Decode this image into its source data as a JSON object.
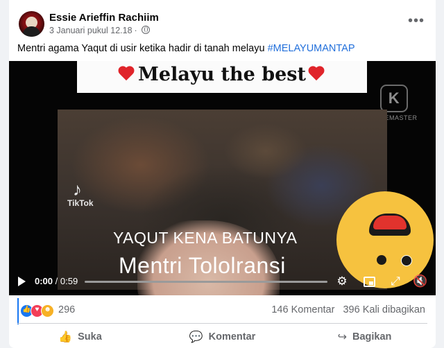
{
  "post": {
    "author": "Essie Arieffin Rachiim",
    "date": "3 Januari pukul 12.18",
    "separator": "·",
    "caption": "Mentri agama Yaqut  di usir ketika hadir di tanah  melayu",
    "hashtag": "#MELAYUMANTAP"
  },
  "video": {
    "banner_text": "Melayu the best",
    "watermark": "KINEMASTER",
    "tiktok_label": "TikTok",
    "overlay_line1": "YAQUT KENA BATUNYA",
    "overlay_line2": "Mentri Tololransi",
    "time_current": "0:00",
    "time_total": "/ 0:59",
    "progress": 0
  },
  "engagement": {
    "reaction_count": "296",
    "comments": "146 Komentar",
    "shares": "396 Kali dibagikan"
  },
  "actions": {
    "like": "Suka",
    "comment": "Komentar",
    "share": "Bagikan"
  },
  "icons": {
    "more": "more-options-icon",
    "globe": "globe-icon",
    "play": "play-icon",
    "settings": "gear-icon",
    "pip": "pip-icon",
    "fullscreen": "fullscreen-icon",
    "mute": "mute-icon",
    "like": "thumbs-up-icon",
    "comment": "comment-icon",
    "share": "share-icon"
  },
  "colors": {
    "hashtag": "#216fdb",
    "like": "#1877f2",
    "love": "#f33e58",
    "haha": "#f7b125"
  }
}
